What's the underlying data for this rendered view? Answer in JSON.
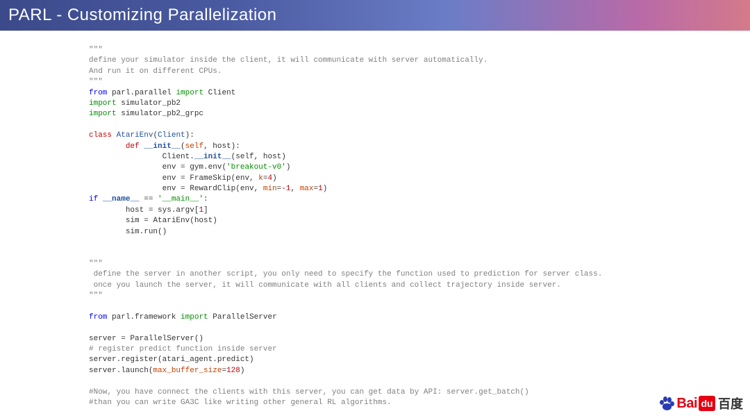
{
  "header": {
    "title": "PARL - Customizing Parallelization"
  },
  "code": {
    "docq1": "\"\"\"",
    "doc1a": "define your simulator inside the client, it will communicate with server automatically.",
    "doc1b": "And run it on different CPUs.",
    "docq2": "\"\"\"",
    "from1": "from",
    "mod1": "parl.parallel",
    "import1": "import",
    "cls1": "Client",
    "import2": "import",
    "mod2": "simulator_pb2",
    "import3": "import",
    "mod3": "simulator_pb2_grpc",
    "class_kw": "class",
    "classname": "AtariEnv",
    "basecls": "Client",
    "def_kw": "def",
    "initfn": "__init__",
    "self_kw": "self",
    "host_arg": "host",
    "client_init": "Client.",
    "init2": "__init__",
    "selfhost": "(self, host)",
    "env1": "env = gym.env(",
    "breakout": "'breakout-v0'",
    "env2": "env = FrameSkip(env, ",
    "k_kw": "k",
    "k_val": "4",
    "env3": "env = RewardClip(env, ",
    "min_kw": "min",
    "max_kw": "max",
    "minus1": "-1",
    "one": "1",
    "if_kw": "if",
    "name_dunder": "__name__",
    "main_str": "'__main__'",
    "host_line": "host = sys.argv[",
    "idx1": "1",
    "sim_line": "sim = AtariEnv(host)",
    "run_line": "sim.run()",
    "docq3": "\"\"\"",
    "doc2a": " define the server in another script, you only need to specify the function used to prediction for server class.",
    "doc2b": " once you launch the server, it will communicate with all clients and collect trajectory inside server.",
    "docq4": "\"\"\"",
    "from2": "from",
    "mod4": "parl.framework",
    "import4": "import",
    "psrv": "ParallelServer",
    "srv1": "server = ParallelServer()",
    "cmt_reg": "# register predict function inside server",
    "srv2": "server.register(atari_agent.predict)",
    "srv3a": "server.launch(",
    "mbs_kw": "max_buffer_size",
    "mbs_val": "128",
    "cmt_end1": "#Now, you have connect the clients with this server, you can get data by API: server.get_batch()",
    "cmt_end2": "#than you can write GA3C like writing other general RL algorithms."
  },
  "logo": {
    "bai": "Bai",
    "du": "du",
    "cn": "百度"
  }
}
